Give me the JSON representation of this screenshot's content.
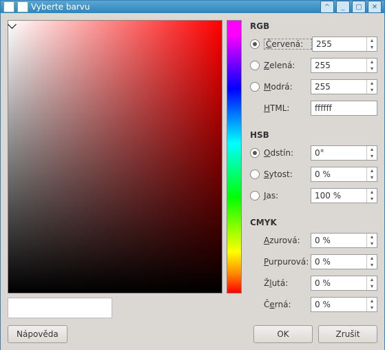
{
  "window": {
    "title": "Vyberte barvu"
  },
  "rgb": {
    "title": "RGB",
    "red": {
      "label": "Červená:",
      "value": "255",
      "selected": true
    },
    "green": {
      "label": "Zelená:",
      "value": "255",
      "selected": false
    },
    "blue": {
      "label": "Modrá:",
      "value": "255",
      "selected": false
    },
    "html": {
      "label": "HTML:",
      "value": "ffffff"
    }
  },
  "hsb": {
    "title": "HSB",
    "hue": {
      "label": "Odstín:",
      "value": "0°",
      "selected": true
    },
    "sat": {
      "label": "Sytost:",
      "value": "0 %",
      "selected": false
    },
    "bri": {
      "label": "Jas:",
      "value": "100 %",
      "selected": false
    }
  },
  "cmyk": {
    "title": "CMYK",
    "c": {
      "label": "Azurová:",
      "value": "0 %"
    },
    "m": {
      "label": "Purpurová:",
      "value": "0 %"
    },
    "y": {
      "label": "Žlutá:",
      "value": "0 %"
    },
    "k": {
      "label": "Černá:",
      "value": "0 %"
    }
  },
  "buttons": {
    "help": "Nápověda",
    "ok": "OK",
    "cancel": "Zrušit"
  }
}
